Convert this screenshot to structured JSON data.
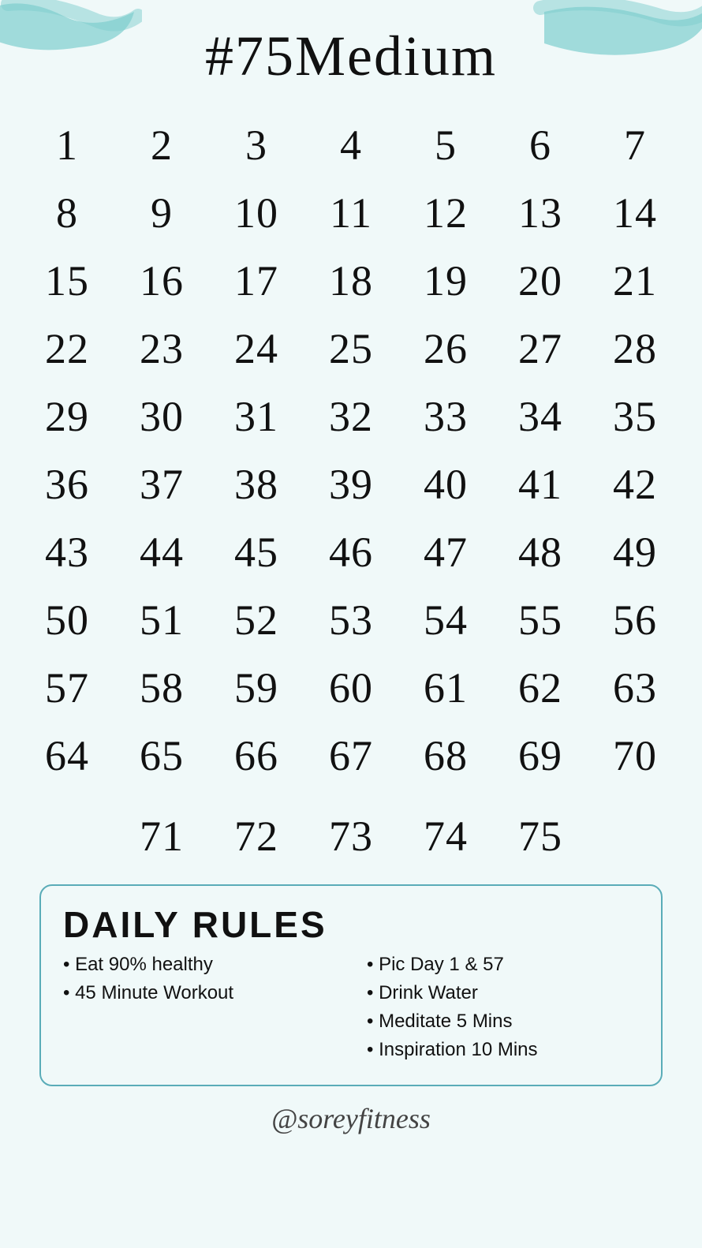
{
  "title": "#75Medium",
  "numbers": {
    "rows": [
      [
        1,
        2,
        3,
        4,
        5,
        6,
        7
      ],
      [
        8,
        9,
        10,
        11,
        12,
        13,
        14
      ],
      [
        15,
        16,
        17,
        18,
        19,
        20,
        21
      ],
      [
        22,
        23,
        24,
        25,
        26,
        27,
        28
      ],
      [
        29,
        30,
        31,
        32,
        33,
        34,
        35
      ],
      [
        36,
        37,
        38,
        39,
        40,
        41,
        42
      ],
      [
        43,
        44,
        45,
        46,
        47,
        48,
        49
      ],
      [
        50,
        51,
        52,
        53,
        54,
        55,
        56
      ],
      [
        57,
        58,
        59,
        60,
        61,
        62,
        63
      ],
      [
        64,
        65,
        66,
        67,
        68,
        69,
        70
      ]
    ],
    "last_row": [
      71,
      72,
      73,
      74,
      75
    ]
  },
  "rules": {
    "title": "DAILY RULES",
    "left_items": [
      "Eat 90% healthy",
      "45 Minute Workout"
    ],
    "right_items": [
      "Pic Day 1 & 57",
      "Drink Water",
      "Meditate 5 Mins",
      "Inspiration 10 Mins"
    ]
  },
  "footer": "@soreyfitness",
  "colors": {
    "accent": "#5aacb8",
    "background": "#f0f9f9",
    "text": "#111111"
  }
}
